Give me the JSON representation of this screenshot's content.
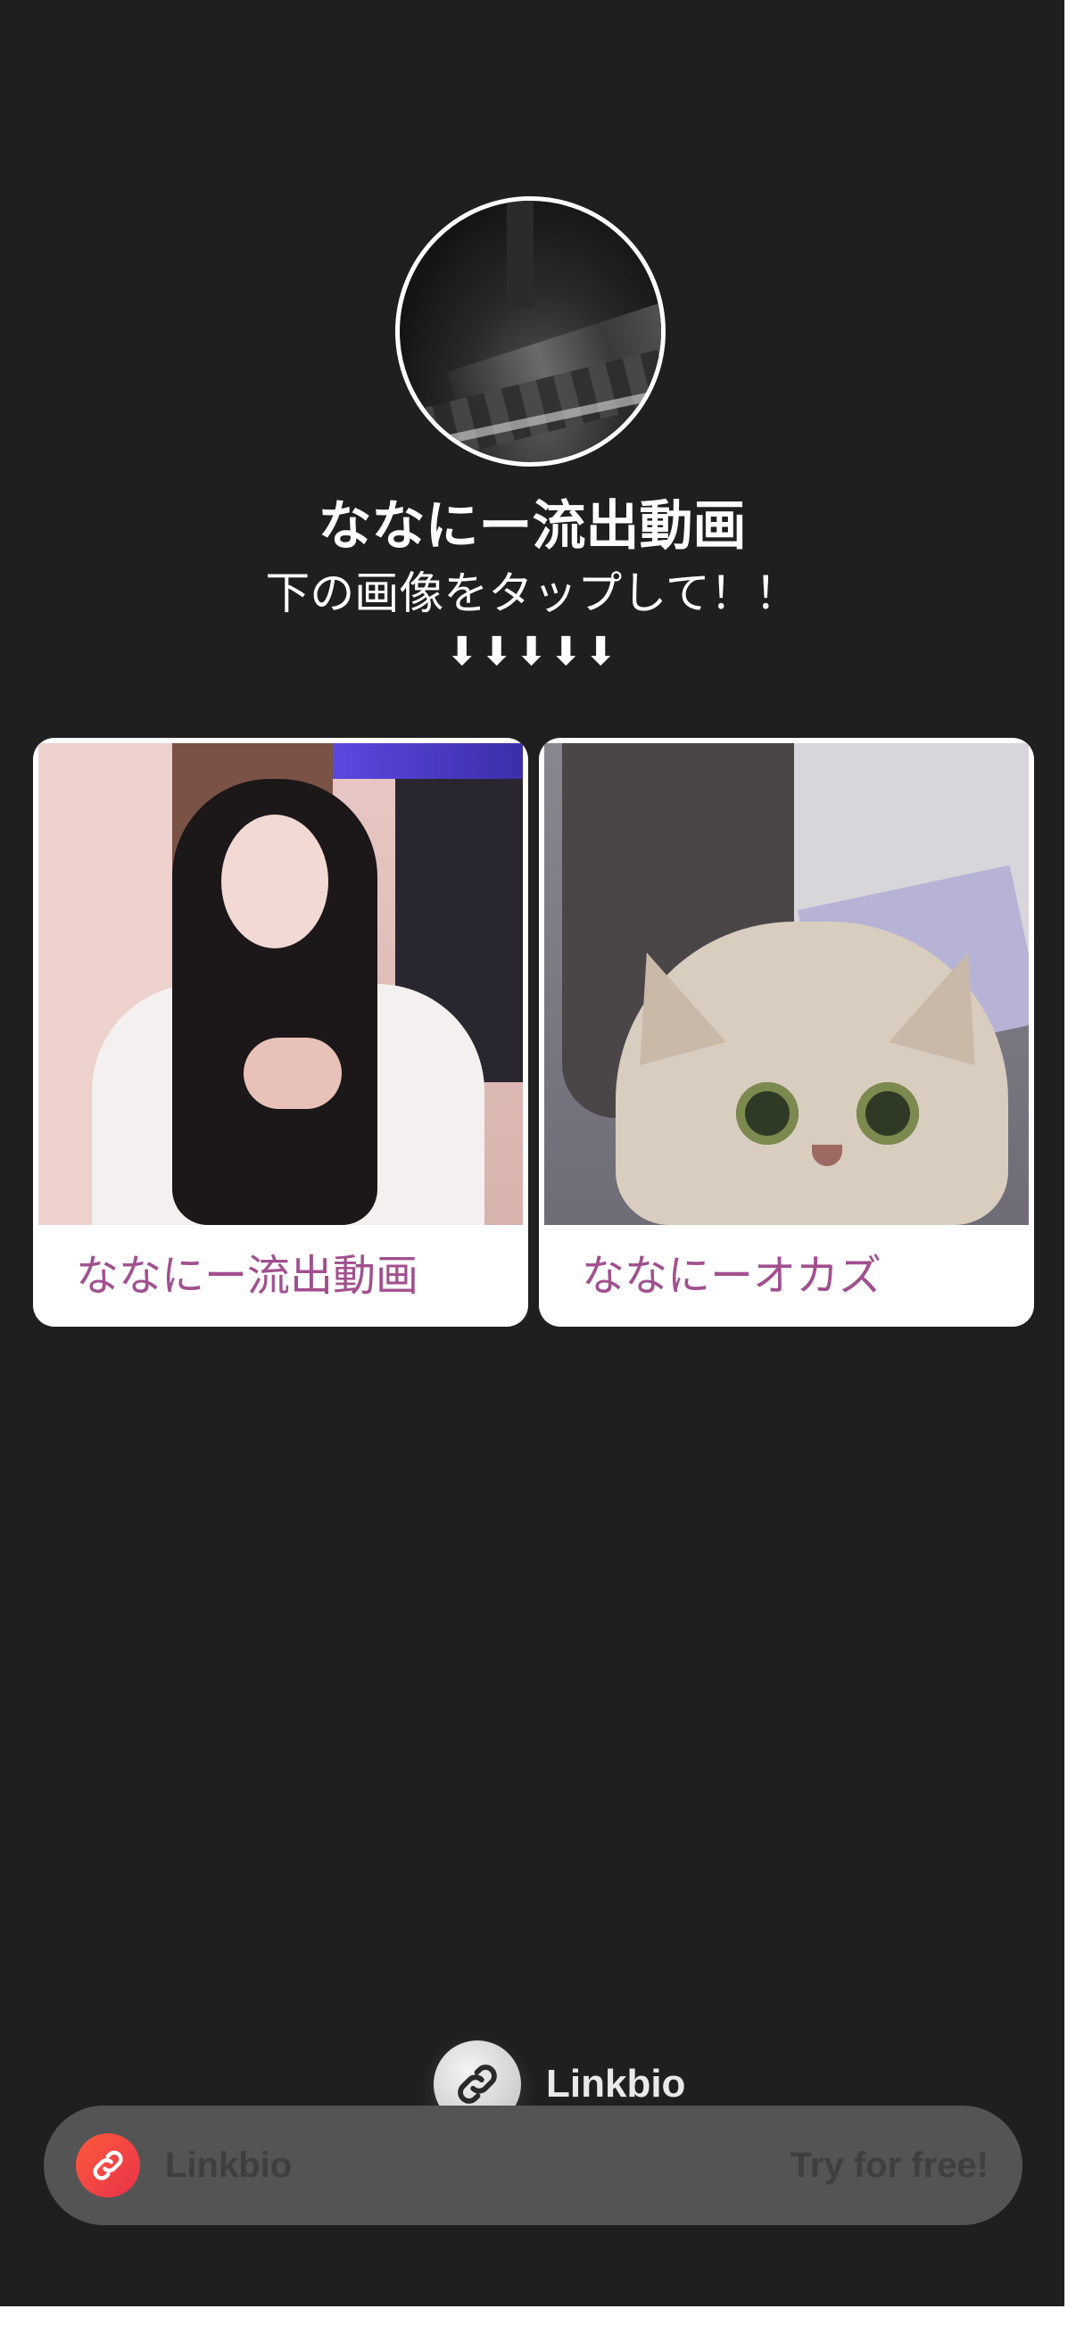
{
  "profile": {
    "title": "ななにー流出動画",
    "subtitle": "下の画像をタップして！！",
    "arrows": "⬇⬇⬇⬇⬇"
  },
  "links": [
    {
      "label": "ななにー流出動画"
    },
    {
      "label": "ななにーオカズ"
    }
  ],
  "branding": {
    "name": "Linkbio"
  },
  "footer": {
    "name": "Linkbio",
    "cta": "Try for free!"
  },
  "colors": {
    "background": "#1f1f1f",
    "link_text": "#a1508f",
    "footer_bar": "#545454",
    "footer_icon": "#ff5a3c"
  }
}
